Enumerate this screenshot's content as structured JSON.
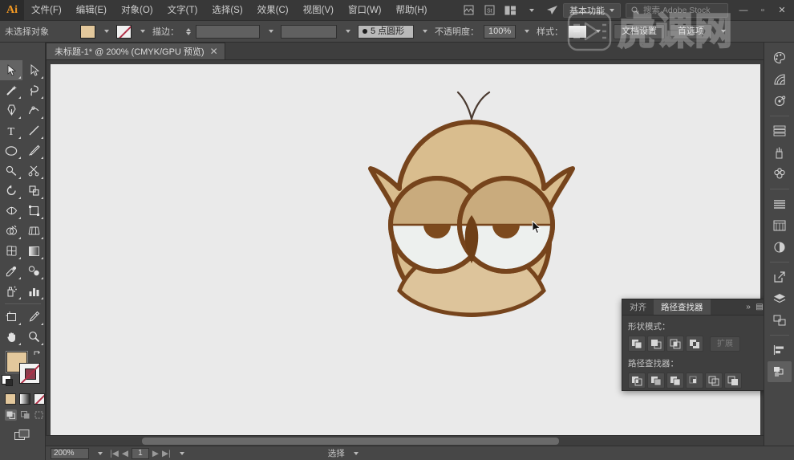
{
  "app": {
    "logo": "Ai",
    "menus": [
      {
        "label": "文件(F)",
        "name": "menu-file"
      },
      {
        "label": "编辑(E)",
        "name": "menu-edit"
      },
      {
        "label": "对象(O)",
        "name": "menu-object"
      },
      {
        "label": "文字(T)",
        "name": "menu-type"
      },
      {
        "label": "选择(S)",
        "name": "menu-select"
      },
      {
        "label": "效果(C)",
        "name": "menu-effect"
      },
      {
        "label": "视图(V)",
        "name": "menu-view"
      },
      {
        "label": "窗口(W)",
        "name": "menu-window"
      },
      {
        "label": "帮助(H)",
        "name": "menu-help"
      }
    ],
    "workspace": "基本功能",
    "search_placeholder": "搜索 Adobe Stock",
    "window_controls": [
      "—",
      "▫",
      "✕"
    ]
  },
  "control_bar": {
    "selection_status": "未选择对象",
    "fill_label": "填色",
    "stroke_label": "描边：",
    "stroke_weight": "",
    "stroke_profile": "",
    "brush_label": "5 点圆形",
    "opacity_label": "不透明度：",
    "opacity_value": "100%",
    "style_label": "样式：",
    "doc_setup": "文档设置",
    "preferences": "首选项",
    "fill_color": "#e3c89c",
    "stroke_color": "#b03048"
  },
  "document": {
    "tab_title": "未标题-1* @ 200% (CMYK/GPU 预览)",
    "close_glyph": "✕"
  },
  "toolbar": {
    "tools": [
      {
        "name": "selection-tool",
        "label": "选择工具",
        "selected": true
      },
      {
        "name": "direct-selection-tool",
        "label": "直接选择工具"
      },
      {
        "name": "magic-wand-tool",
        "label": "魔棒工具"
      },
      {
        "name": "lasso-tool",
        "label": "套索工具"
      },
      {
        "name": "pen-tool",
        "label": "钢笔工具"
      },
      {
        "name": "curvature-tool",
        "label": "曲率工具"
      },
      {
        "name": "type-tool",
        "label": "文字工具"
      },
      {
        "name": "line-segment-tool",
        "label": "直线段工具"
      },
      {
        "name": "ellipse-tool",
        "label": "椭圆工具"
      },
      {
        "name": "paintbrush-tool",
        "label": "画笔工具"
      },
      {
        "name": "pencil-tool",
        "label": "铅笔工具"
      },
      {
        "name": "scissors-tool",
        "label": "剪刀工具"
      },
      {
        "name": "rotate-tool",
        "label": "旋转工具"
      },
      {
        "name": "scale-tool",
        "label": "比例缩放工具"
      },
      {
        "name": "width-tool",
        "label": "宽度工具"
      },
      {
        "name": "free-transform-tool",
        "label": "自由变换工具"
      },
      {
        "name": "shape-builder-tool",
        "label": "形状生成器工具"
      },
      {
        "name": "perspective-grid-tool",
        "label": "透视网格工具"
      },
      {
        "name": "mesh-tool",
        "label": "网格工具"
      },
      {
        "name": "gradient-tool",
        "label": "渐变工具"
      },
      {
        "name": "eyedropper-tool",
        "label": "吸管工具"
      },
      {
        "name": "blend-tool",
        "label": "混合工具"
      },
      {
        "name": "symbol-sprayer-tool",
        "label": "符号喷枪工具"
      },
      {
        "name": "column-graph-tool",
        "label": "柱形图工具"
      },
      {
        "name": "artboard-tool",
        "label": "画板工具"
      },
      {
        "name": "slice-tool",
        "label": "切片工具"
      },
      {
        "name": "hand-tool",
        "label": "抓手工具"
      },
      {
        "name": "zoom-tool",
        "label": "缩放工具"
      }
    ],
    "fill_color": "#e3c89c",
    "stroke_color": "#8d3b4c",
    "mode_buttons": [
      "color-swatch",
      "gradient-swatch",
      "none-swatch"
    ],
    "draw_modes": [
      "draw-normal",
      "draw-behind",
      "draw-inside"
    ],
    "screen_mode": "screen-mode-button"
  },
  "canvas": {
    "background": "#eaeaea",
    "artwork_name": "owl-illustration",
    "colors": {
      "body": "#d9bd8e",
      "body_light": "#ddc49b",
      "outline": "#76441c",
      "wing": "#c8a871",
      "eye_white": "#edf0ee",
      "eyelid": "#c9ab7d",
      "pupil": "#7d4a1d",
      "beak": "#6e3f17",
      "antenna": "#4a3a30"
    },
    "cursor": "arrow-cursor"
  },
  "pathfinder_panel": {
    "tabs": [
      {
        "label": "对齐",
        "name": "tab-align",
        "active": false
      },
      {
        "label": "路径查找器",
        "name": "tab-pathfinder",
        "active": true
      }
    ],
    "collapse_glyph": "»",
    "menu_glyph": "▤",
    "shape_modes_label": "形状模式：",
    "pathfinders_label": "路径查找器：",
    "expand_label": "扩展",
    "shape_modes": [
      {
        "name": "unite-button",
        "label": "联集"
      },
      {
        "name": "minus-front-button",
        "label": "减去顶层"
      },
      {
        "name": "intersect-button",
        "label": "交集"
      },
      {
        "name": "exclude-button",
        "label": "差集"
      }
    ],
    "pathfinders": [
      {
        "name": "divide-button",
        "label": "分割"
      },
      {
        "name": "trim-button",
        "label": "修边"
      },
      {
        "name": "merge-button",
        "label": "合并"
      },
      {
        "name": "crop-button",
        "label": "裁剪"
      },
      {
        "name": "outline-button",
        "label": "轮廓"
      },
      {
        "name": "minus-back-button",
        "label": "减去后方对象"
      }
    ]
  },
  "right_dock": {
    "icons": [
      {
        "name": "color-panel-icon",
        "label": "颜色"
      },
      {
        "name": "color-guide-panel-icon",
        "label": "颜色参考"
      },
      {
        "name": "swatches-panel-icon",
        "label": "色板"
      },
      {
        "name": "brushes-panel-icon",
        "label": "画笔"
      },
      {
        "name": "symbols-panel-icon",
        "label": "符号"
      },
      {
        "name": "stroke-panel-icon",
        "label": "描边"
      },
      {
        "name": "gradient-panel-icon",
        "label": "渐变"
      },
      {
        "name": "transparency-panel-icon",
        "label": "透明度"
      },
      {
        "name": "export-panel-icon",
        "label": "资源导出"
      },
      {
        "name": "layers-panel-icon",
        "label": "图层"
      },
      {
        "name": "artboards-panel-icon",
        "label": "画板"
      },
      {
        "name": "align-panel-icon",
        "label": "对齐"
      },
      {
        "name": "pathfinder-panel-icon",
        "label": "路径查找器",
        "active": true
      }
    ]
  },
  "status_bar": {
    "zoom": "200%",
    "artboard_number": "1",
    "current_tool": "选择",
    "first_glyph": "|◀",
    "prev_glyph": "◀",
    "next_glyph": "▶",
    "last_glyph": "▶|"
  },
  "watermark": {
    "text": "虎课网"
  }
}
